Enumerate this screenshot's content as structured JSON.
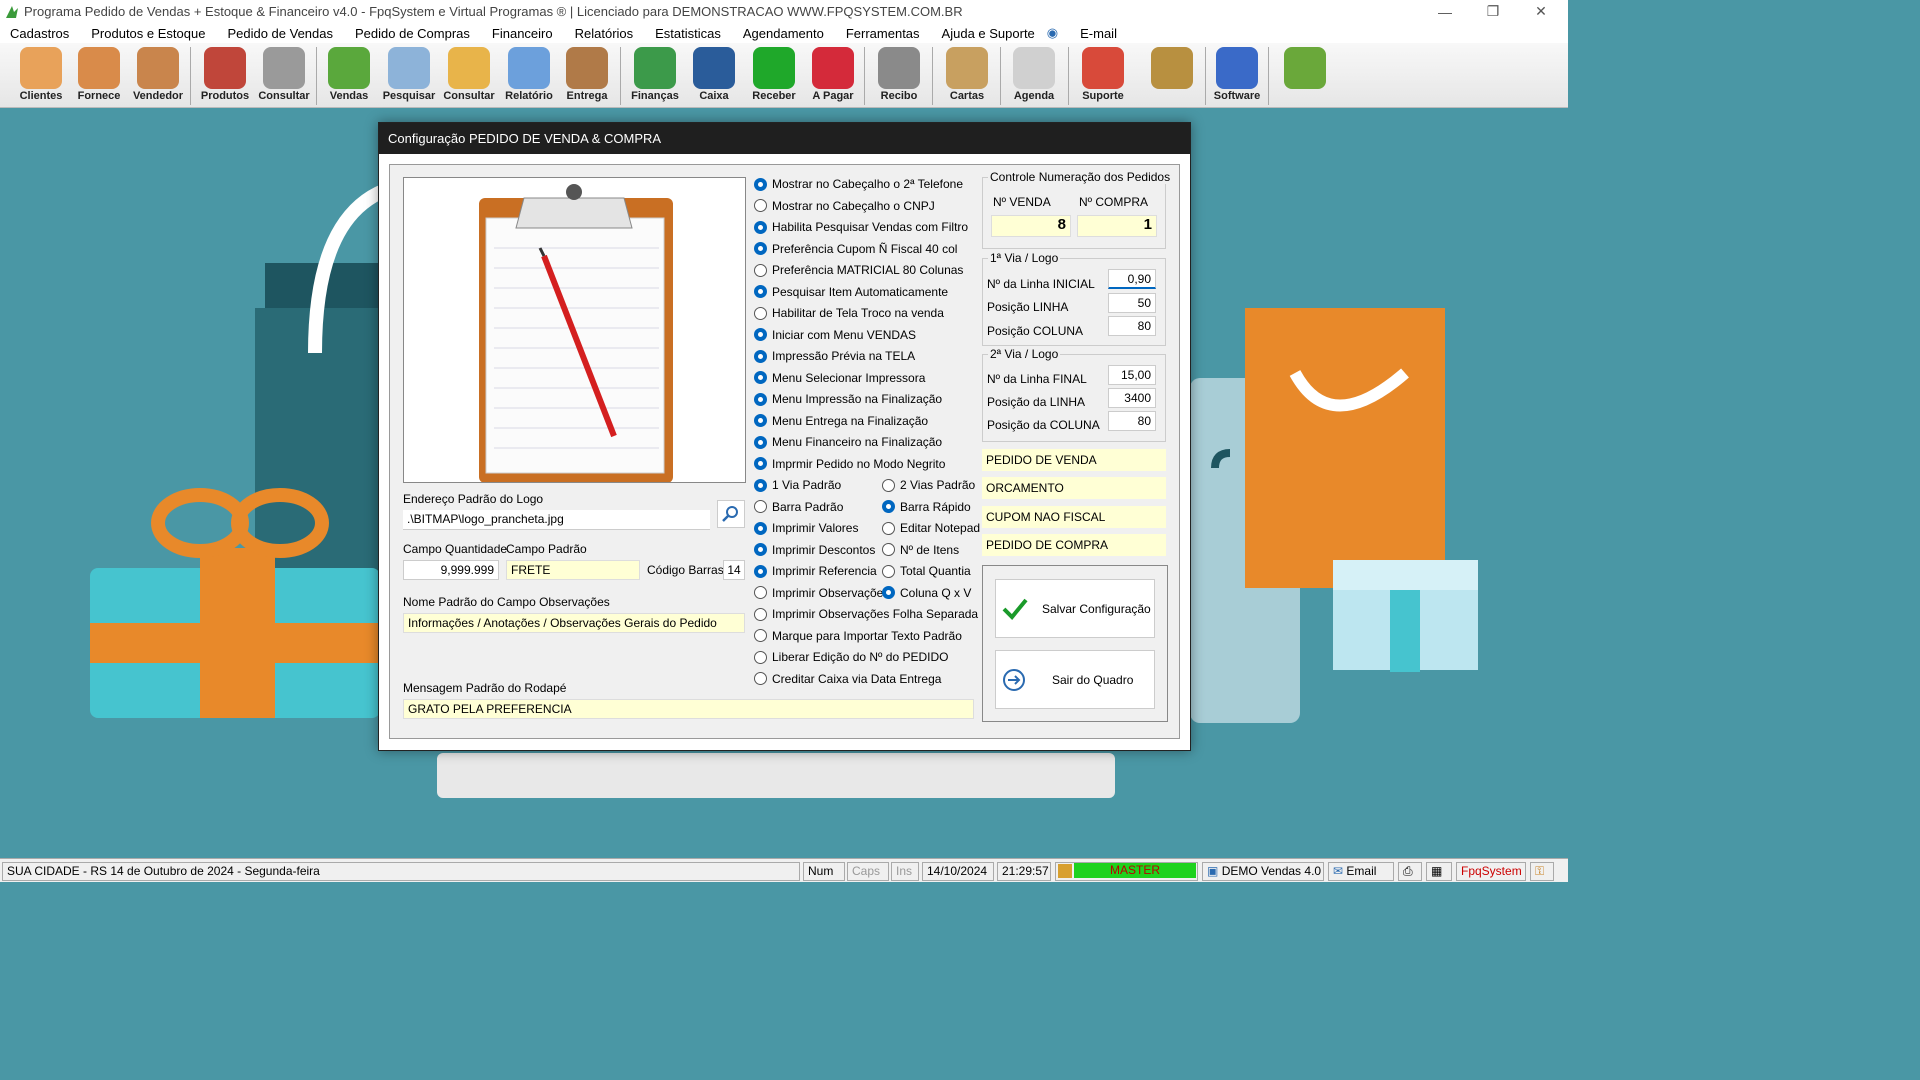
{
  "window": {
    "title": "Programa Pedido de Vendas + Estoque & Financeiro v4.0 - FpqSystem e Virtual Programas ® | Licenciado para  DEMONSTRACAO WWW.FPQSYSTEM.COM.BR"
  },
  "menu": [
    "Cadastros",
    "Produtos e Estoque",
    "Pedido de Vendas",
    "Pedido de Compras",
    "Financeiro",
    "Relatórios",
    "Estatisticas",
    "Agendamento",
    "Ferramentas",
    "Ajuda e Suporte",
    "E-mail"
  ],
  "toolbar": [
    {
      "label": "Clientes",
      "icon": "clients-icon",
      "color": "#e8a25a"
    },
    {
      "label": "Fornece",
      "icon": "supplier-icon",
      "color": "#d98b4a"
    },
    {
      "label": "Vendedor",
      "icon": "seller-icon",
      "color": "#c9854c"
    },
    {
      "label": "Produtos",
      "icon": "products-icon",
      "color": "#c0463a"
    },
    {
      "label": "Consultar",
      "icon": "barcode-icon",
      "color": "#9a9a9a"
    },
    {
      "label": "Vendas",
      "icon": "cart-icon",
      "color": "#5aa83c"
    },
    {
      "label": "Pesquisar",
      "icon": "search-doc-icon",
      "color": "#8db3d9"
    },
    {
      "label": "Consultar",
      "icon": "folder-icon",
      "color": "#e8b44a"
    },
    {
      "label": "Relatório",
      "icon": "report-icon",
      "color": "#6ca0dc"
    },
    {
      "label": "Entrega",
      "icon": "delivery-icon",
      "color": "#b07a48"
    },
    {
      "label": "Finanças",
      "icon": "finance-icon",
      "color": "#3c9a4a"
    },
    {
      "label": "Caixa",
      "icon": "cashbox-icon",
      "color": "#2a5c9a"
    },
    {
      "label": "Receber",
      "icon": "receive-dollar-icon",
      "color": "#1fa82a"
    },
    {
      "label": "A Pagar",
      "icon": "pay-dollar-icon",
      "color": "#d42a3a"
    },
    {
      "label": "Recibo",
      "icon": "receipt-icon",
      "color": "#8a8a8a"
    },
    {
      "label": "Cartas",
      "icon": "letters-icon",
      "color": "#c8a060"
    },
    {
      "label": "Agenda",
      "icon": "agenda-icon",
      "color": "#d0d0d0"
    },
    {
      "label": "Suporte",
      "icon": "support-icon",
      "color": "#d84a3a"
    },
    {
      "label": "",
      "icon": "coin-icon",
      "color": "#b89040"
    },
    {
      "label": "Software",
      "icon": "software-icon",
      "color": "#3a6ac8"
    },
    {
      "label": "",
      "icon": "exit-icon",
      "color": "#6aa83a"
    }
  ],
  "dialog": {
    "title": "Configuração PEDIDO DE VENDA & COMPRA",
    "logo_label": "Endereço Padrão do Logo",
    "logo_path": ".\\BITMAP\\logo_prancheta.jpg",
    "qty_label": "Campo Quantidade",
    "qty_value": "9,999.999",
    "default_label": "Campo Padrão",
    "default_value": "FRETE",
    "barcode_label": "Código Barras:",
    "barcode_value": "14",
    "obs_label": "Nome Padrão do Campo Observações",
    "obs_value": "Informações / Anotações / Observações Gerais do Pedido",
    "footer_label": "Mensagem Padrão do Rodapé",
    "footer_value": "GRATO PELA PREFERENCIA",
    "options": [
      {
        "label": "Mostrar no Cabeçalho o 2ª Telefone",
        "on": true
      },
      {
        "label": "Mostrar no Cabeçalho o CNPJ",
        "on": false
      },
      {
        "label": "Habilita Pesquisar Vendas com Filtro",
        "on": true
      },
      {
        "label": "Preferência Cupom Ñ Fiscal 40 col",
        "on": true
      },
      {
        "label": "Preferência MATRICIAL 80 Colunas",
        "on": false
      },
      {
        "label": "Pesquisar Item Automaticamente",
        "on": true
      },
      {
        "label": "Habilitar de Tela Troco na venda",
        "on": false
      },
      {
        "label": "Iniciar com Menu VENDAS",
        "on": true
      },
      {
        "label": "Impressão Prévia na TELA",
        "on": true
      },
      {
        "label": "Menu Selecionar Impressora",
        "on": true
      },
      {
        "label": "Menu Impressão na Finalização",
        "on": true
      },
      {
        "label": "Menu Entrega na Finalização",
        "on": true
      },
      {
        "label": "Menu Financeiro na Finalização",
        "on": true
      },
      {
        "label": "Imprmir Pedido no Modo Negrito",
        "on": true
      }
    ],
    "options_pairs": [
      {
        "a": "1 Via Padrão",
        "a_on": true,
        "b": "2 Vias Padrão",
        "b_on": false
      },
      {
        "a": "Barra Padrão",
        "a_on": false,
        "b": "Barra Rápido",
        "b_on": true
      },
      {
        "a": "Imprimir Valores",
        "a_on": true,
        "b": "Editar Notepad",
        "b_on": false
      },
      {
        "a": "Imprimir Descontos",
        "a_on": true,
        "b": "Nº de Itens",
        "b_on": false
      },
      {
        "a": "Imprimir Referencia",
        "a_on": true,
        "b": "Total Quantia",
        "b_on": false
      },
      {
        "a": "Imprimir Observações",
        "a_on": false,
        "b": "Coluna Q x V",
        "b_on": true
      }
    ],
    "options_tail": [
      {
        "label": "Imprimir Observações Folha Separada",
        "on": false
      },
      {
        "label": "Marque para Importar Texto Padrão",
        "on": false
      },
      {
        "label": "Liberar Edição do Nº do PEDIDO",
        "on": false
      },
      {
        "label": "Creditar Caixa via Data Entrega",
        "on": false
      }
    ],
    "numbering": {
      "title": "Controle Numeração dos Pedidos",
      "sale_label": "Nº VENDA",
      "sale_value": "8",
      "purchase_label": "Nº COMPRA",
      "purchase_value": "1"
    },
    "via1": {
      "title": "1ª Via / Logo",
      "r1_label": "Nº da Linha INICIAL",
      "r1_value": "0,90",
      "r2_label": "Posição LINHA",
      "r2_value": "50",
      "r3_label": "Posição COLUNA",
      "r3_value": "80"
    },
    "via2": {
      "title": "2ª Via / Logo",
      "r1_label": "Nº da Linha FINAL",
      "r1_value": "15,00",
      "r2_label": "Posição da LINHA",
      "r2_value": "3400",
      "r3_label": "Posição da COLUNA",
      "r3_value": "80"
    },
    "doc_names": [
      "PEDIDO DE VENDA",
      "ORCAMENTO",
      "CUPOM NAO FISCAL",
      "PEDIDO DE COMPRA"
    ],
    "save_label": "Salvar Configuração",
    "exit_label": "Sair do Quadro"
  },
  "status": {
    "location": "SUA CIDADE - RS 14 de Outubro de 2024 - Segunda-feira",
    "num": "Num",
    "caps": "Caps",
    "ins": "Ins",
    "date": "14/10/2024",
    "time": "21:29:57",
    "master": "MASTER",
    "version": "DEMO Vendas 4.0",
    "email": "Email",
    "brand": "FpqSystem"
  }
}
